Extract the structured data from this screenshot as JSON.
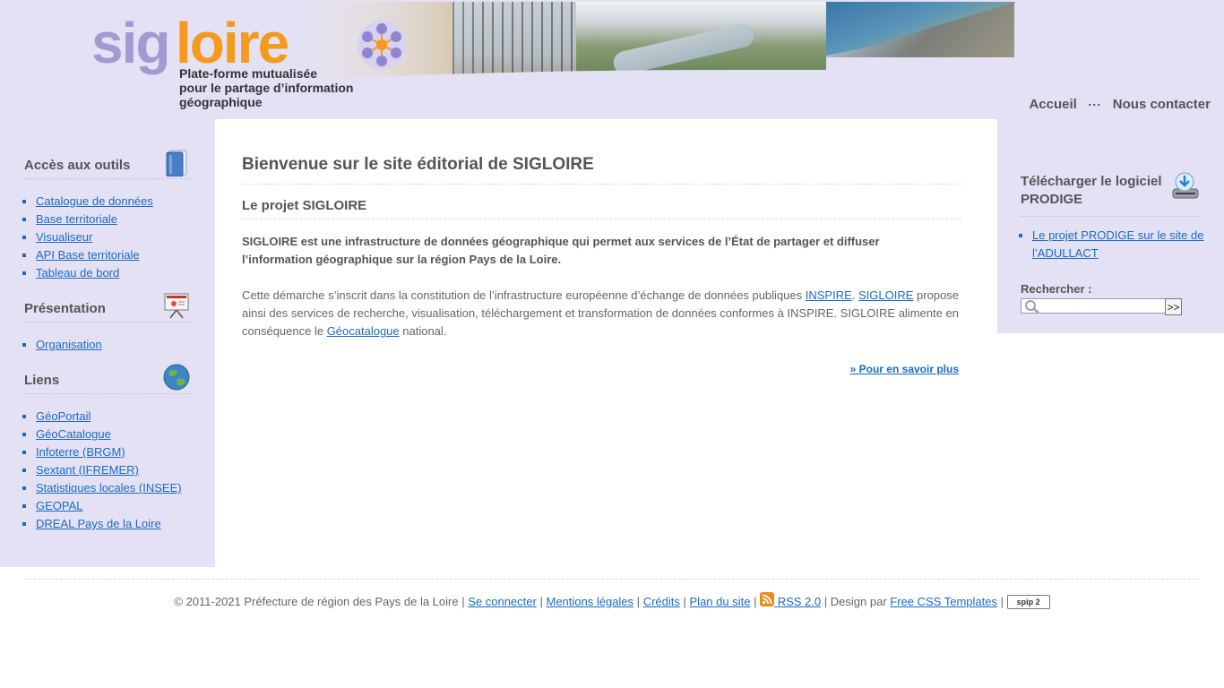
{
  "header": {
    "logo": {
      "sig": "sig",
      "loire": "loire",
      "subtitle_line1": "Plate-forme mutualisée",
      "subtitle_line2": "pour le partage d’information géographique"
    },
    "nav": [
      {
        "label": "Accueil"
      },
      {
        "label": "Nous contacter"
      }
    ]
  },
  "left_sidebar": {
    "sections": [
      {
        "title": "Accès aux outils",
        "icon": "book-icon",
        "items": [
          "Catalogue de données",
          "Base territoriale",
          "Visualiseur",
          "API Base territoriale",
          "Tableau de bord"
        ]
      },
      {
        "title": "Présentation",
        "icon": "presentation-board-icon",
        "items": [
          "Organisation"
        ]
      },
      {
        "title": "Liens",
        "icon": "globe-icon",
        "items": [
          "GéoPortail",
          "GéoCatalogue",
          "Infoterre (BRGM)",
          "Sextant (IFREMER)",
          "Statistiques locales (INSEE)",
          "GEOPAL",
          "DREAL Pays de la Loire"
        ]
      }
    ]
  },
  "main": {
    "title": "Bienvenue sur le site éditorial de SIGLOIRE",
    "section_title": "Le projet SIGLOIRE",
    "intro": "SIGLOIRE est une infrastructure de données géographique qui permet aux services de l’État de partager et diffuser l’information géographique sur la région Pays de la Loire.",
    "body": {
      "part1": "Cette démarche s’inscrit dans la constitution de l’infrastructure européenne d’échange de données publiques ",
      "link_inspire": "INSPIRE",
      "part2": ". ",
      "link_sigloire": "SIGLOIRE",
      "part3": " propose ainsi des services de recherche, visualisation, téléchargement et transformation de données conformes à INSPIRE. SIGLOIRE alimente en conséquence le ",
      "link_geocatalogue": "Géocatalogue",
      "part4": " national."
    },
    "more_link": "» Pour en savoir plus"
  },
  "right_sidebar": {
    "download_title": "Télécharger le logiciel PRODIGE",
    "download_icon": "download-icon",
    "download_link": "Le projet PRODIGE sur le site de l’ADULLACT",
    "search_label": "Rechercher :",
    "search_value": "",
    "search_button": ">>"
  },
  "footer": {
    "copyright": "© 2011-2021 Préfecture de région des Pays de la Loire",
    "sep": "|",
    "login": "Se connecter",
    "legal": "Mentions légales",
    "credits": "Crédits",
    "sitemap": "Plan du site",
    "rss": "RSS 2.0",
    "design_by": "Design par",
    "templates": "Free CSS Templates",
    "spip": "spip 2"
  },
  "colors": {
    "accent_lavender": "#e4e1f4",
    "link": "#1a6bc4",
    "logo_purple": "#a49ad1",
    "logo_orange": "#f49a1f"
  }
}
